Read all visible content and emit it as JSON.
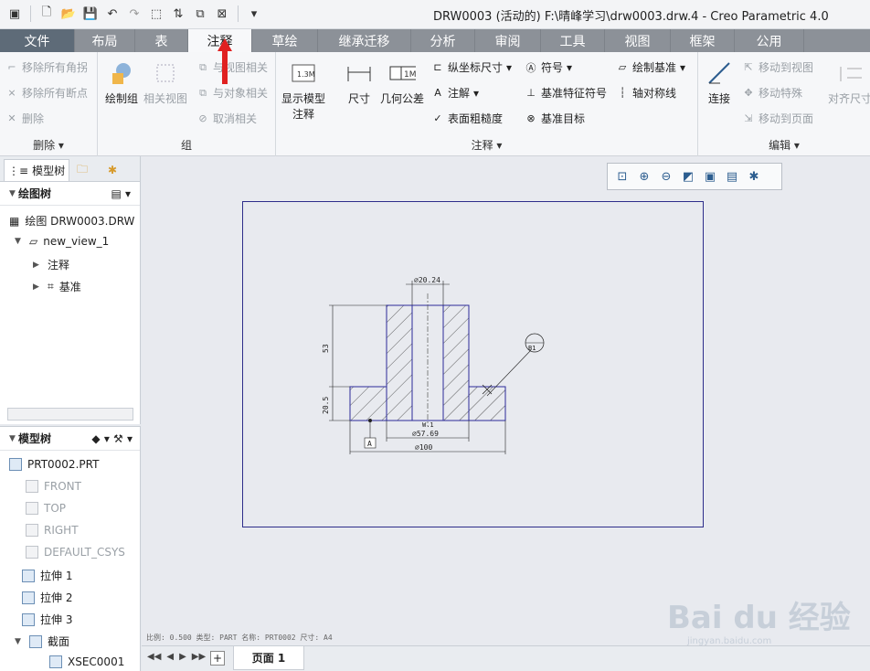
{
  "window": {
    "title": "DRW0003 (活动的) F:\\晴峰学习\\drw0003.drw.4 - Creo Parametric 4.0"
  },
  "tabs": [
    "文件",
    "布局",
    "表",
    "注释",
    "草绘",
    "继承迁移",
    "分析",
    "审阅",
    "工具",
    "视图",
    "框架",
    "公用"
  ],
  "active_tab": "注释",
  "ribbon": {
    "delete_group": {
      "label": "删除",
      "items": [
        "移除所有角拐",
        "移除所有断点",
        "删除"
      ]
    },
    "group_group": {
      "label": "组",
      "big1": "绘制组",
      "big2": "相关视图",
      "items": [
        "与视图相关",
        "与对象相关",
        "取消相关"
      ]
    },
    "annotation_group": {
      "label": "注释",
      "show_model": "显示模型\n注释",
      "show_model_l1": "显示模型",
      "show_model_l2": "注释",
      "dimension": "尺寸",
      "gtol": "几何公差",
      "col1": [
        "纵坐标尺寸",
        "注解",
        "表面粗糙度"
      ],
      "col2": [
        "符号",
        "基准特征符号",
        "基准目标"
      ],
      "col3": [
        "绘制基准",
        "轴对称线"
      ]
    },
    "edit_group": {
      "label": "编辑",
      "connect": "连接",
      "items": [
        "移动到视图",
        "移动特殊",
        "移动到页面"
      ],
      "align": "对齐尺寸"
    }
  },
  "left_panel": {
    "tab_model_tree": "模型树",
    "drawing_tree_header": "绘图树",
    "drawing_tree": [
      {
        "label": "绘图 DRW0003.DRW"
      },
      {
        "label": "new_view_1"
      },
      {
        "label": "注释"
      },
      {
        "label": "基准"
      }
    ],
    "model_tree_header": "模型树",
    "model_tree": [
      {
        "label": "PRT0002.PRT",
        "grey": false
      },
      {
        "label": "FRONT",
        "grey": true
      },
      {
        "label": "TOP",
        "grey": true
      },
      {
        "label": "RIGHT",
        "grey": true
      },
      {
        "label": "DEFAULT_CSYS",
        "grey": true
      },
      {
        "label": "拉伸 1",
        "grey": false
      },
      {
        "label": "拉伸 2",
        "grey": false
      },
      {
        "label": "拉伸 3",
        "grey": false
      },
      {
        "label": "截面",
        "grey": false
      },
      {
        "label": "XSEC0001",
        "grey": false
      }
    ]
  },
  "drawing": {
    "dim_top": "⌀20.24",
    "dim_left_upper": "53",
    "dim_left_lower": "20.5",
    "dim_mid": "⌀57.69",
    "dim_bottom": "⌀100",
    "mid_text": "W.1",
    "datum_label": "A",
    "balloon_label": "B1"
  },
  "status": {
    "text": "比例: 0.500   类型: PART   名称: PRT0002   尺寸: A4"
  },
  "pagebar": {
    "page_label": "页面 1",
    "add": "+"
  },
  "watermark": {
    "brand": "Bai du 经验",
    "url": "jingyan.baidu.com"
  }
}
